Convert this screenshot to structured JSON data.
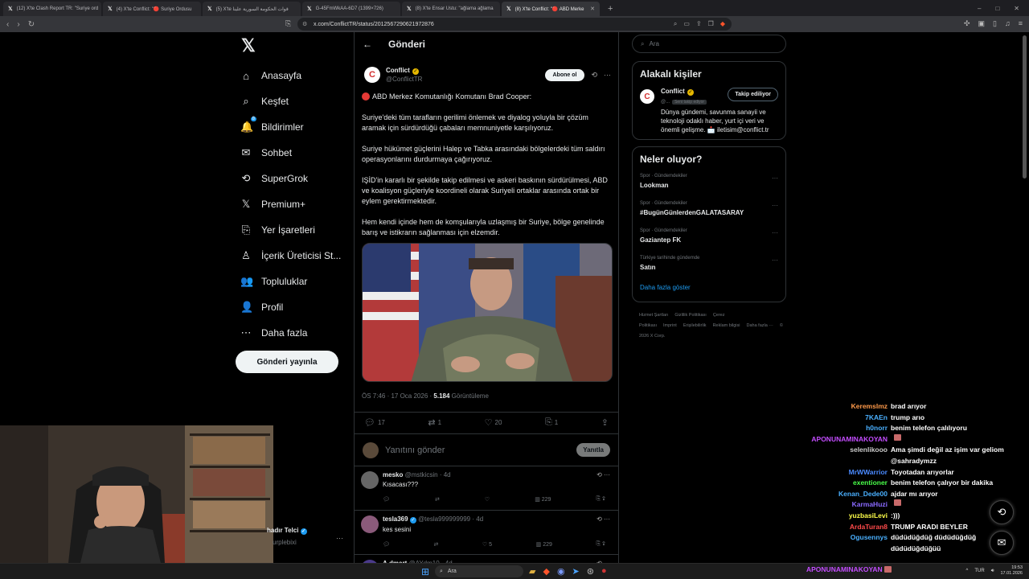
{
  "browser": {
    "tabs": [
      {
        "label": "(12) X'te Clash Report TR: \"Suriye ord",
        "active": false
      },
      {
        "label": "(4) X'te Conflict: \"🔴 Suriye Ordusu",
        "active": false
      },
      {
        "label": "(5) X'te قوات الحكومة السورية علينا",
        "active": false
      },
      {
        "label": "G-45FmWkAA-6D7 (1399×726)",
        "active": false
      },
      {
        "label": "(8) X'te Ensar Ustu: \"ağlama ağlama",
        "active": false
      },
      {
        "label": "(8) X'te Conflict: \"🔴 ABD Merke",
        "active": true
      }
    ],
    "url": "x.com/ConflictTR/status/2012567290621972876",
    "new_tab": "+",
    "window_controls": [
      "–",
      "□",
      "✕"
    ]
  },
  "nav": {
    "logo": "𝕏",
    "items": [
      {
        "icon": "⌂",
        "label": "Anasayfa",
        "name": "home"
      },
      {
        "icon": "⌕",
        "label": "Keşfet",
        "name": "explore"
      },
      {
        "icon": "🔔",
        "label": "Bildirimler",
        "name": "notifications",
        "badge": "8"
      },
      {
        "icon": "✉",
        "label": "Sohbet",
        "name": "chat"
      },
      {
        "icon": "⟲",
        "label": "SuperGrok",
        "name": "supergrok"
      },
      {
        "icon": "𝕏",
        "label": "Premium+",
        "name": "premium"
      },
      {
        "icon": "⎘",
        "label": "Yer İşaretleri",
        "name": "bookmarks"
      },
      {
        "icon": "♙",
        "label": "İçerik Üreticisi St...",
        "name": "creator-studio"
      },
      {
        "icon": "👥",
        "label": "Topluluklar",
        "name": "communities"
      },
      {
        "icon": "👤",
        "label": "Profil",
        "name": "profile"
      },
      {
        "icon": "⋯",
        "label": "Daha fazla",
        "name": "more"
      }
    ],
    "post_button": "Gönderi yayınla"
  },
  "main": {
    "header_title": "Gönderi",
    "author": {
      "name": "Conflict",
      "handle": "@ConflictTR"
    },
    "follow_button": "Abone ol",
    "paragraphs": [
      "ABD Merkez Komutanlığı Komutanı Brad Cooper:",
      "Suriye'deki tüm tarafların gerilimi önlemek ve diyalog yoluyla bir çözüm aramak için sürdürdüğü çabaları memnuniyetle karşılıyoruz.",
      "Suriye hükümet güçlerini Halep ve Tabka arasındaki bölgelerdeki tüm saldırı operasyonlarını durdurmaya çağırıyoruz.",
      "IŞİD'in kararlı bir şekilde takip edilmesi ve askeri baskının sürdürülmesi, ABD ve koalisyon güçleriyle koordineli olarak Suriyeli ortaklar arasında ortak bir eylem gerektirmektedir.",
      "Hem kendi içinde hem de komşularıyla uzlaşmış bir Suriye, bölge genelinde barış ve istikrarın sağlanması için elzemdir."
    ],
    "timestamp": "ÖS 7:46 · 17 Oca 2026 · ",
    "views_count": "5.184",
    "views_label": " Görüntüleme",
    "actions": {
      "replies": "17",
      "reposts": "1",
      "likes": "20",
      "bookmarks": "1"
    },
    "reply_placeholder": "Yanıtını gönder",
    "reply_button": "Yanıtla",
    "replies": [
      {
        "name": "mesko",
        "handle": "@mstkicsin",
        "age": "· 4d",
        "text": "Kısacası???",
        "likes": "",
        "views": "229",
        "avatar": "#666"
      },
      {
        "name": "tesla369",
        "handle": "@tesla999999999",
        "age": "· 4d",
        "text": "kes sesini",
        "likes": "5",
        "views": "229",
        "avatar": "#8a5a7a",
        "verified": true
      },
      {
        "name": "A.dmart",
        "handle": "@AYdm10",
        "age": "· 4d",
        "text": "",
        "likes": "",
        "views": "",
        "avatar": "#4a3a8a"
      }
    ]
  },
  "sidebar": {
    "search_placeholder": "Ara",
    "people_title": "Alakalı kişiler",
    "person": {
      "name": "Conflict",
      "handle": "@...",
      "follows_you": "Seni takip ediyor",
      "bio": "Dünya gündemi, savunma sanayii ve teknoloji odaklı haber, yurt içi veri ve önemli gelişme. 📩 iletisim@conflict.tr",
      "button": "Takip ediliyor"
    },
    "trends_title": "Neler oluyor?",
    "trends": [
      {
        "category": "Spor · Gündemdekiler",
        "name": "Lookman"
      },
      {
        "category": "Spor · Gündemdekiler",
        "name": "#BugünGünlerdenGALATASARAY"
      },
      {
        "category": "Spor · Gündemdekiler",
        "name": "Gaziantep FK"
      },
      {
        "category": "Türkiye tarihinde gündemde",
        "name": "Satın"
      }
    ],
    "show_more": "Daha fazla göster",
    "footer_links": [
      "Hizmet Şartları",
      "Gizlilik Politikası",
      "Çerez Politikası",
      "Imprint",
      "Erişilebilirlik",
      "Reklam bilgisi",
      "Daha fazla ···",
      "© 2026 X Corp."
    ]
  },
  "stream": {
    "cam_user": "hadır Telci",
    "cam_handle": "urplebixi",
    "chat": [
      {
        "user": "Keremslmz",
        "color": "#ff9a4a",
        "msg": "brad arıyor"
      },
      {
        "user": "7KAEn",
        "color": "#4ab0ff",
        "msg": "trump arıo"
      },
      {
        "user": "h0norr",
        "color": "#4ab0ff",
        "msg": "benim telefon çalılıyoru"
      },
      {
        "user": "APONUNAMINAKOYAN",
        "color": "#c44dff",
        "msg": "",
        "emote": true
      },
      {
        "user": "selenlikooo",
        "color": "#cccccc",
        "msg": "Ama şimdi değil az işim var geliom"
      },
      {
        "user": "",
        "color": "#cccccc",
        "msg": "@sahradymzz"
      },
      {
        "user": "MrWWarrior",
        "color": "#4a8aff",
        "msg": "Toyotadan arıyorlar"
      },
      {
        "user": "exentioner",
        "color": "#4aff4a",
        "msg": "benim telefon çalıyor bir dakika"
      },
      {
        "user": "Kenan_Dede00",
        "color": "#4ab0ff",
        "msg": "ajdar mı arıyor"
      },
      {
        "user": "KarmaHuzi",
        "color": "#8a6aff",
        "msg": "",
        "emote": true
      },
      {
        "user": "yuzbasiLevi",
        "color": "#ffff4a",
        "msg": ":)))"
      },
      {
        "user": "ArdaTuran8",
        "color": "#ff4a4a",
        "msg": "TRUMP ARADI BEYLER"
      },
      {
        "user": "Ogusennys",
        "color": "#4ab0ff",
        "msg": "düdüdüğdüğ düdüdüğdüğ"
      },
      {
        "user": "",
        "color": "#cccccc",
        "msg": "düdüdüğdüğüü"
      }
    ],
    "chat_bottom_user": "APONUNAMINAKOYAN"
  },
  "taskbar": {
    "search": "Ara",
    "lang": "TUR",
    "time": "19:53",
    "date": "17.01.2026"
  }
}
